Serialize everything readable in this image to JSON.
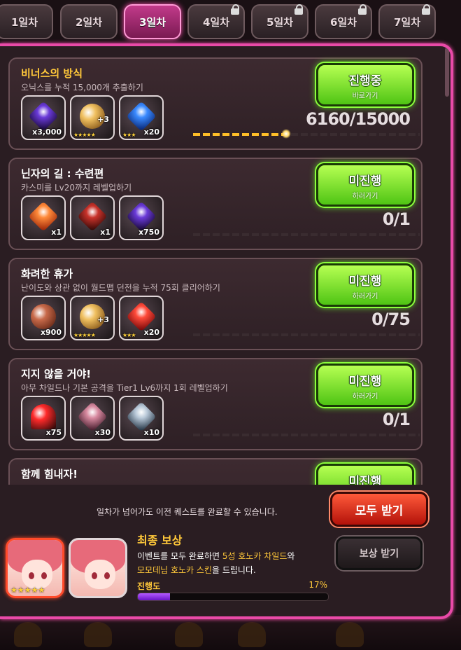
{
  "tabs": [
    {
      "label": "1일차",
      "locked": false
    },
    {
      "label": "2일차",
      "locked": false
    },
    {
      "label": "3일차",
      "locked": false,
      "active": true
    },
    {
      "label": "4일차",
      "locked": true
    },
    {
      "label": "5일차",
      "locked": true
    },
    {
      "label": "6일차",
      "locked": true
    },
    {
      "label": "7일차",
      "locked": true
    }
  ],
  "quests": [
    {
      "title": "비너스의 방식",
      "description": "오닉스를 누적 15,000개 추출하기",
      "items": [
        {
          "icon": "dark-gem-icon",
          "count": "x3,000"
        },
        {
          "icon": "gold-medal-icon",
          "stars": "★★★★★",
          "plus": "+3"
        },
        {
          "icon": "blue-gem-icon",
          "count": "x20",
          "stars": "★★★"
        }
      ],
      "progress_text": "6160/15000",
      "progress_fraction": 0.41,
      "button_main": "진행중",
      "button_sub": "바로가기"
    },
    {
      "title": "닌자의 길 : 수련편",
      "description": "카스미를 Lv20까지 레벨업하기",
      "items": [
        {
          "icon": "ticket-icon",
          "count": "x1"
        },
        {
          "icon": "card-pack-icon",
          "count": "x1"
        },
        {
          "icon": "dark-gem-icon",
          "count": "x750"
        }
      ],
      "progress_text": "0/1",
      "progress_fraction": 0,
      "button_main": "미진행",
      "button_sub": "하러가기"
    },
    {
      "title": "화려한 휴가",
      "description": "난이도와 상관 없이 월드맵 던전을 누적 75회 클리어하기",
      "items": [
        {
          "icon": "bronze-coin-icon",
          "count": "x900"
        },
        {
          "icon": "gold-medal-icon",
          "stars": "★★★★★",
          "plus": "+3"
        },
        {
          "icon": "red-gem-icon",
          "count": "x20",
          "stars": "★★★"
        }
      ],
      "progress_text": "0/75",
      "progress_fraction": 0,
      "button_main": "미진행",
      "button_sub": "하러가기"
    },
    {
      "title": "지지 않을 거야!",
      "description": "아무 차일드나 기본 공격을 Tier1 Lv6까지 1회 레벨업하기",
      "items": [
        {
          "icon": "heart-icon",
          "count": "x75"
        },
        {
          "icon": "crystal-cluster-icon",
          "count": "x30"
        },
        {
          "icon": "gear-part-icon",
          "count": "x10"
        }
      ],
      "progress_text": "0/1",
      "progress_fraction": 0,
      "button_main": "미진행",
      "button_sub": "하러가기"
    },
    {
      "title": "함께 힘내자!",
      "description": "",
      "items": [],
      "progress_text": "",
      "progress_fraction": 0,
      "button_main": "미진행",
      "button_sub": ""
    }
  ],
  "footer": {
    "notice": "일차가 넘어가도 이전 퀘스트를 완료할 수 있습니다.",
    "claim_all": "모두 받기"
  },
  "final_reward": {
    "title": "최종 보상",
    "line1_a": "이벤트를 모두 완료하면 ",
    "line1_b": "5성 호노카 차일드",
    "line1_c": "와",
    "line2_a": "모모데님 호노카 스킨",
    "line2_b": "을 드립니다.",
    "progress_label": "진행도",
    "progress_pct": "17%",
    "progress_fraction": 0.17,
    "portrait_stars": "★★★★★",
    "claim_button": "보상 받기"
  },
  "colors": {
    "accent_pink": "#e94aa8",
    "button_green": "#7be82a",
    "claim_red": "#d82a1a",
    "gold_text": "#ffc83a",
    "progress_purple": "#9b3aef"
  }
}
